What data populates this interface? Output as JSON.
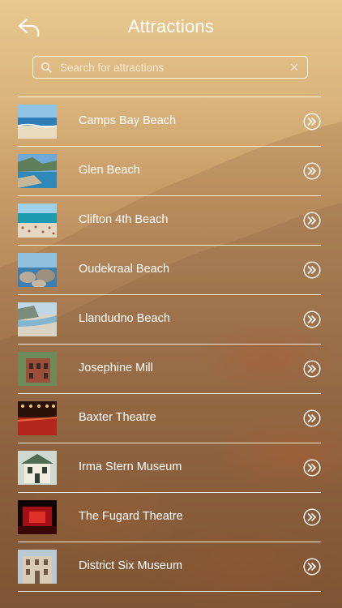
{
  "header": {
    "title": "Attractions",
    "back_icon": "back-arrow-icon"
  },
  "search": {
    "placeholder": "Search for attractions",
    "value": "",
    "clear_glyph": "✕",
    "icon": "search-icon"
  },
  "attractions": [
    {
      "label": "Camps Bay Beach",
      "thumb": "beach"
    },
    {
      "label": "Glen Beach",
      "thumb": "cove"
    },
    {
      "label": "Clifton 4th Beach",
      "thumb": "crowd"
    },
    {
      "label": "Oudekraal Beach",
      "thumb": "rocks"
    },
    {
      "label": "Llandudno Beach",
      "thumb": "bay"
    },
    {
      "label": "Josephine Mill",
      "thumb": "mill"
    },
    {
      "label": "Baxter Theatre",
      "thumb": "theatre-red"
    },
    {
      "label": "Irma Stern Museum",
      "thumb": "house"
    },
    {
      "label": "The Fugard Theatre",
      "thumb": "stage"
    },
    {
      "label": "District Six Museum",
      "thumb": "building"
    }
  ],
  "colors": {
    "text": "#ffffff",
    "background_top": "#e8c98f",
    "background_bottom": "#845836"
  }
}
